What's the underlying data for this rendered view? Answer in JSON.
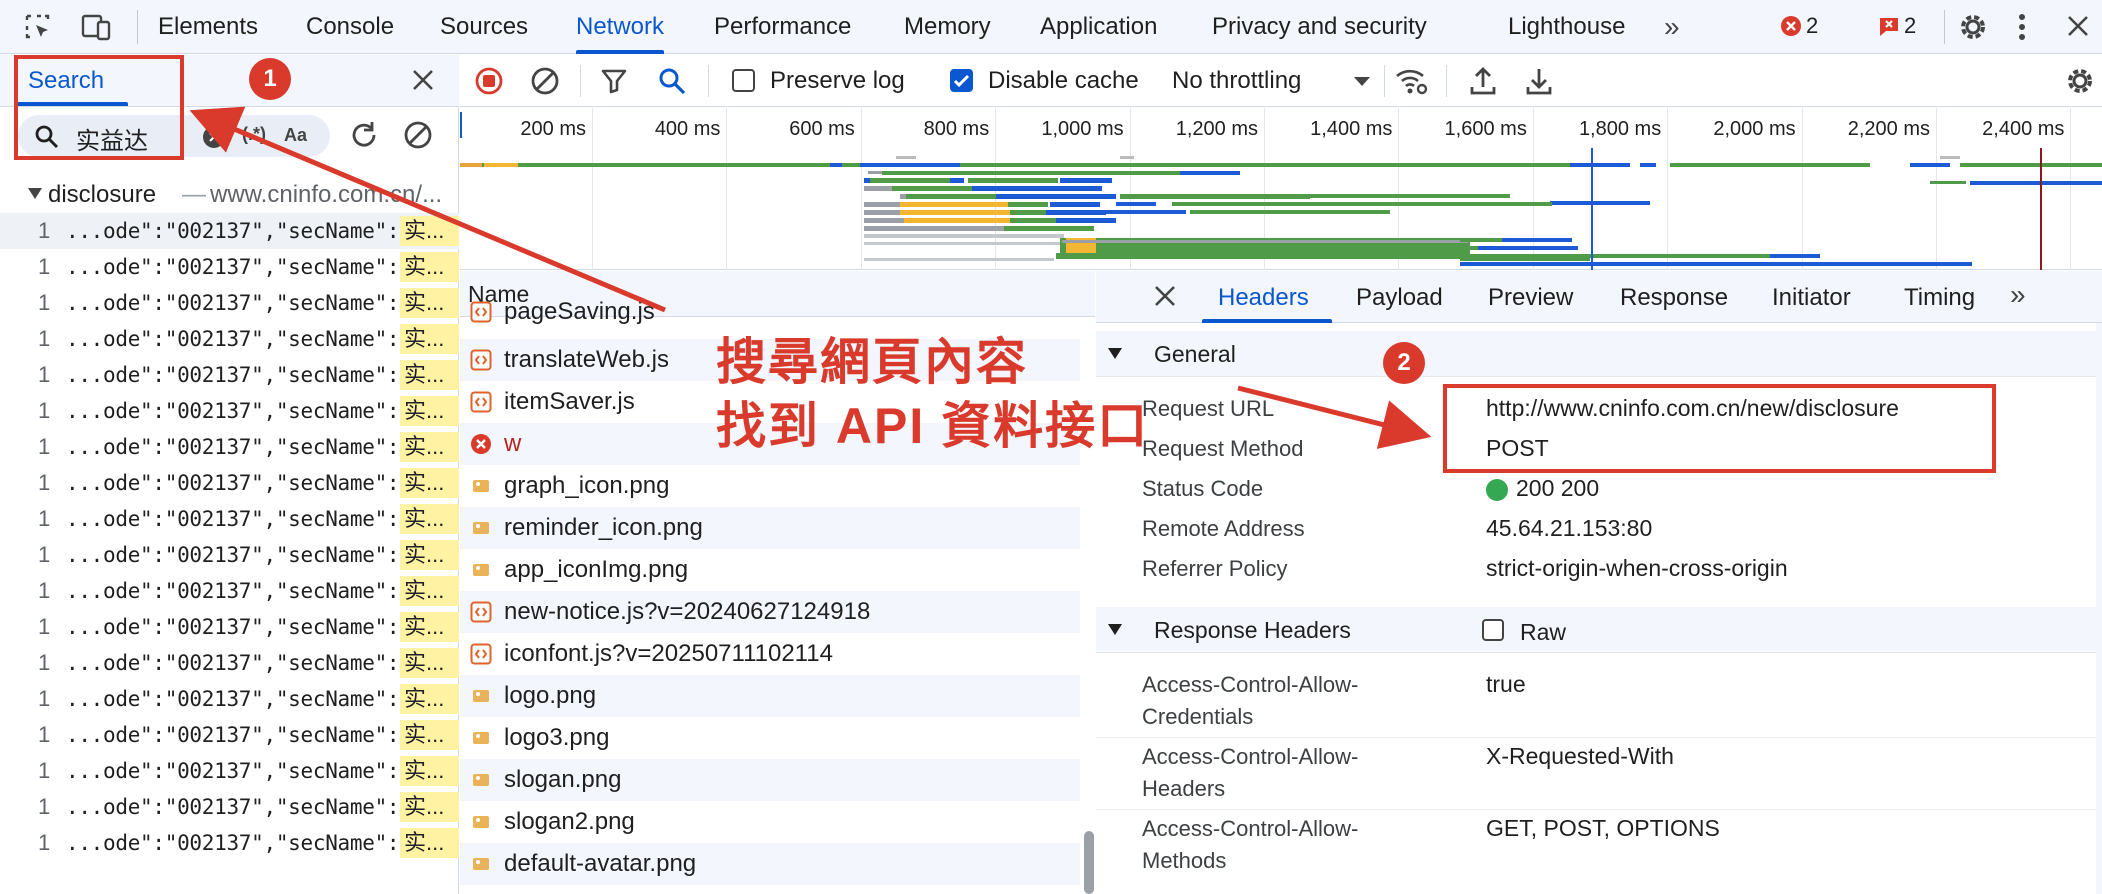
{
  "topbar": {
    "tabs": [
      "Elements",
      "Console",
      "Sources",
      "Network",
      "Performance",
      "Memory",
      "Application",
      "Privacy and security",
      "Lighthouse"
    ],
    "active_tab": "Network",
    "more_label": "»",
    "error_count": "2",
    "issue_count": "2"
  },
  "search_panel": {
    "tab_label": "Search",
    "query": "实益达",
    "regex_label": "(.*)",
    "case_label": "Aa",
    "group": {
      "name": "disclosure",
      "separator": "—",
      "url": "www.cninfo.com.cn/..."
    },
    "results": [
      {
        "line": "1",
        "text": "...ode\":\"002137\",\"secName\":\"",
        "match": "实..."
      },
      {
        "line": "1",
        "text": "...ode\":\"002137\",\"secName\":\"",
        "match": "实..."
      },
      {
        "line": "1",
        "text": "...ode\":\"002137\",\"secName\":\"",
        "match": "实..."
      },
      {
        "line": "1",
        "text": "...ode\":\"002137\",\"secName\":\"",
        "match": "实..."
      },
      {
        "line": "1",
        "text": "...ode\":\"002137\",\"secName\":\"",
        "match": "实..."
      },
      {
        "line": "1",
        "text": "...ode\":\"002137\",\"secName\":\"",
        "match": "实..."
      },
      {
        "line": "1",
        "text": "...ode\":\"002137\",\"secName\":\"",
        "match": "实..."
      },
      {
        "line": "1",
        "text": "...ode\":\"002137\",\"secName\":\"",
        "match": "实..."
      },
      {
        "line": "1",
        "text": "...ode\":\"002137\",\"secName\":\"",
        "match": "实..."
      },
      {
        "line": "1",
        "text": "...ode\":\"002137\",\"secName\":\"",
        "match": "实..."
      },
      {
        "line": "1",
        "text": "...ode\":\"002137\",\"secName\":\"",
        "match": "实..."
      },
      {
        "line": "1",
        "text": "...ode\":\"002137\",\"secName\":\"",
        "match": "实..."
      },
      {
        "line": "1",
        "text": "...ode\":\"002137\",\"secName\":\"",
        "match": "实..."
      },
      {
        "line": "1",
        "text": "...ode\":\"002137\",\"secName\":\"",
        "match": "实..."
      },
      {
        "line": "1",
        "text": "...ode\":\"002137\",\"secName\":\"",
        "match": "实..."
      },
      {
        "line": "1",
        "text": "...ode\":\"002137\",\"secName\":\"",
        "match": "实..."
      },
      {
        "line": "1",
        "text": "...ode\":\"002137\",\"secName\":\"",
        "match": "实..."
      },
      {
        "line": "1",
        "text": "...ode\":\"002137\",\"secName\":\"",
        "match": "实..."
      }
    ]
  },
  "toolbar": {
    "preserve_log_label": "Preserve log",
    "preserve_log_checked": false,
    "disable_cache_label": "Disable cache",
    "disable_cache_checked": true,
    "throttling": "No throttling"
  },
  "timeline": {
    "ticks": [
      "200 ms",
      "400 ms",
      "600 ms",
      "800 ms",
      "1,000 ms",
      "1,200 ms",
      "1,400 ms",
      "1,600 ms",
      "1,800 ms",
      "2,000 ms",
      "2,200 ms",
      "2,400 ms"
    ]
  },
  "request_list": {
    "header": "Name",
    "rows": [
      {
        "name": "pageSaving.js",
        "type": "script"
      },
      {
        "name": "translateWeb.js",
        "type": "script"
      },
      {
        "name": "itemSaver.js",
        "type": "script"
      },
      {
        "name": "w",
        "type": "error"
      },
      {
        "name": "graph_icon.png",
        "type": "image"
      },
      {
        "name": "reminder_icon.png",
        "type": "image"
      },
      {
        "name": "app_iconImg.png",
        "type": "image"
      },
      {
        "name": "new-notice.js?v=20240627124918",
        "type": "script"
      },
      {
        "name": "iconfont.js?v=20250711102114",
        "type": "script"
      },
      {
        "name": "logo.png",
        "type": "image"
      },
      {
        "name": "logo3.png",
        "type": "image"
      },
      {
        "name": "slogan.png",
        "type": "image"
      },
      {
        "name": "slogan2.png",
        "type": "image"
      },
      {
        "name": "default-avatar.png",
        "type": "image"
      }
    ]
  },
  "details": {
    "tabs": [
      "Headers",
      "Payload",
      "Preview",
      "Response",
      "Initiator",
      "Timing"
    ],
    "active_tab": "Headers",
    "more_label": "»",
    "general": {
      "title": "General",
      "rows": [
        {
          "key": "Request URL",
          "value": "http://www.cninfo.com.cn/new/disclosure"
        },
        {
          "key": "Request Method",
          "value": "POST"
        },
        {
          "key": "Status Code",
          "value": "200 200"
        },
        {
          "key": "Remote Address",
          "value": "45.64.21.153:80"
        },
        {
          "key": "Referrer Policy",
          "value": "strict-origin-when-cross-origin"
        }
      ]
    },
    "response_headers": {
      "title": "Response Headers",
      "raw_label": "Raw",
      "rows": [
        {
          "key1": "Access-Control-Allow-",
          "key2": "Credentials",
          "value": "true"
        },
        {
          "key1": "Access-Control-Allow-",
          "key2": "Headers",
          "value": "X-Requested-With"
        },
        {
          "key1": "Access-Control-Allow-",
          "key2": "Methods",
          "value": "GET, POST, OPTIONS"
        }
      ]
    }
  },
  "annotations": {
    "badge1": "1",
    "badge2": "2",
    "caption_line1": "搜尋網頁內容",
    "caption_line2": "找到 API 資料接口",
    "color": "#d93a2b"
  }
}
